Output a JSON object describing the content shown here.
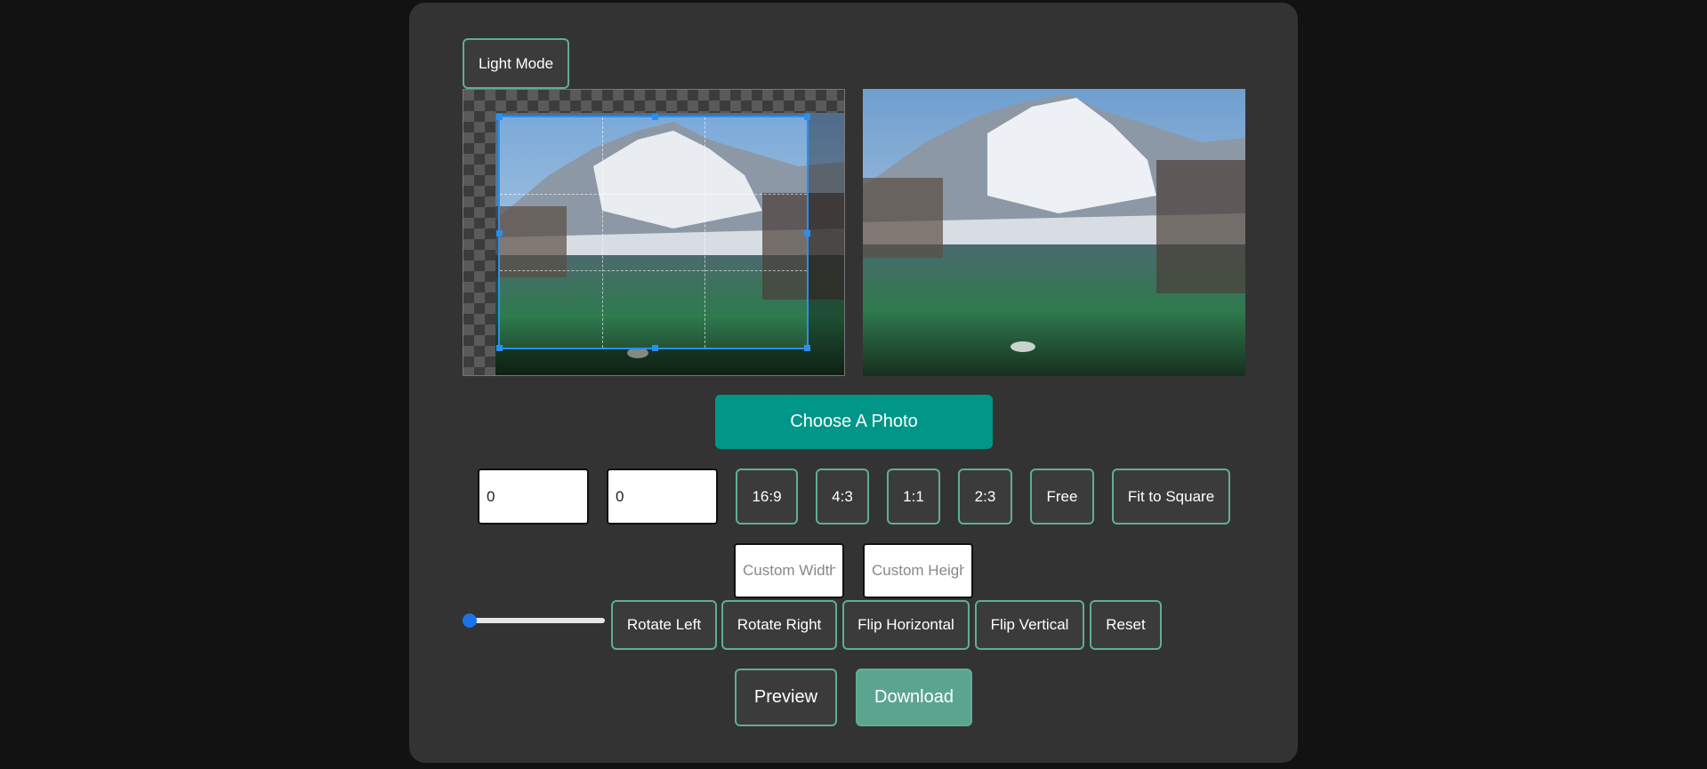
{
  "theme_toggle": {
    "label": "Light Mode"
  },
  "upload": {
    "label": "Choose A Photo"
  },
  "dimensions": {
    "width_value": "0",
    "height_value": "0"
  },
  "aspect_ratios": [
    "16:9",
    "4:3",
    "1:1",
    "2:3",
    "Free"
  ],
  "fit_square": {
    "label": "Fit to Square"
  },
  "custom": {
    "width_placeholder": "Custom Width",
    "height_placeholder": "Custom Height"
  },
  "zoom": {
    "value": 0
  },
  "transforms": {
    "rotate_left": "Rotate Left",
    "rotate_right": "Rotate Right",
    "flip_horizontal": "Flip Horizontal",
    "flip_vertical": "Flip Vertical",
    "reset": "Reset"
  },
  "actions": {
    "preview": "Preview",
    "download": "Download"
  },
  "colors": {
    "accent": "#009688",
    "border": "#5fae94",
    "download_bg": "#5ba58f",
    "panel": "#333333",
    "page": "#121212"
  }
}
